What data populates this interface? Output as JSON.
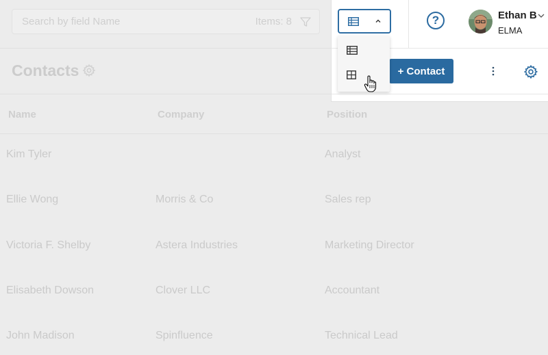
{
  "search": {
    "placeholder": "Search by field Name",
    "items_count": "Items: 8"
  },
  "page": {
    "title": "Contacts"
  },
  "table": {
    "columns": [
      "Name",
      "Company",
      "Position"
    ],
    "rows": [
      {
        "name": "Kim Tyler",
        "company": "",
        "position": "Analyst"
      },
      {
        "name": "Ellie Wong",
        "company": "Morris & Co",
        "position": "Sales rep"
      },
      {
        "name": "Victoria F. Shelby",
        "company": "Astera Industries",
        "position": "Marketing Director"
      },
      {
        "name": "Elisabeth Dowson",
        "company": "Clover LLC",
        "position": "Accountant"
      },
      {
        "name": "John Madison",
        "company": "Spinfluence",
        "position": "Technical Lead"
      }
    ]
  },
  "toolbar": {
    "view_selector": {
      "selected_icon": "list-view-icon",
      "expanded": true
    },
    "view_options": [
      {
        "icon": "list-view-icon"
      },
      {
        "icon": "grid-view-icon"
      }
    ],
    "help_label": "?",
    "add_contact_label": "+ Contact",
    "more_icon": "vertical-dots-icon",
    "settings_icon": "gear-icon"
  },
  "user": {
    "name": "Ethan B",
    "org": "ELMA"
  },
  "colors": {
    "accent": "#2a6aa0",
    "background": "#ececec",
    "panel": "#ffffff"
  }
}
